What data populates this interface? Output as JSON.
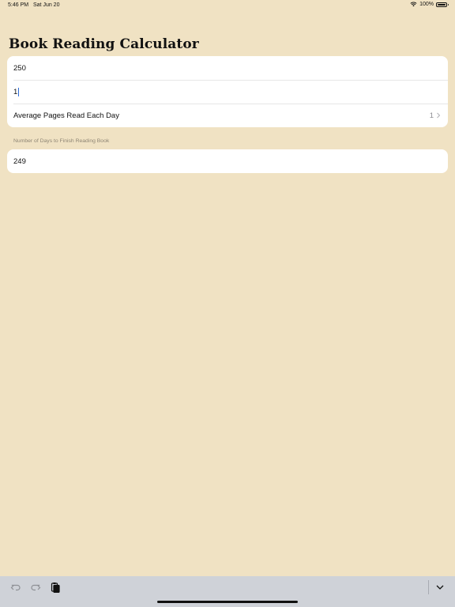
{
  "status_bar": {
    "time": "5:46 PM",
    "date": "Sat Jun 20",
    "battery": "100%"
  },
  "page": {
    "title": "Book Reading Calculator"
  },
  "form": {
    "total_pages_value": "250",
    "pages_read_value": "1",
    "average_row": {
      "label": "Average Pages Read Each Day",
      "value": "1"
    }
  },
  "result": {
    "header": "Number of Days to Finish Reading Book",
    "value": "249"
  },
  "keyboard_toolbar": {
    "undo_icon": "undo-icon",
    "redo_icon": "redo-icon",
    "paste_icon": "paste-icon",
    "dismiss_icon": "chevron-down-icon"
  },
  "colors": {
    "background": "#f0e2c3",
    "card": "#ffffff",
    "keyboard_bar": "#cfd2d8"
  }
}
